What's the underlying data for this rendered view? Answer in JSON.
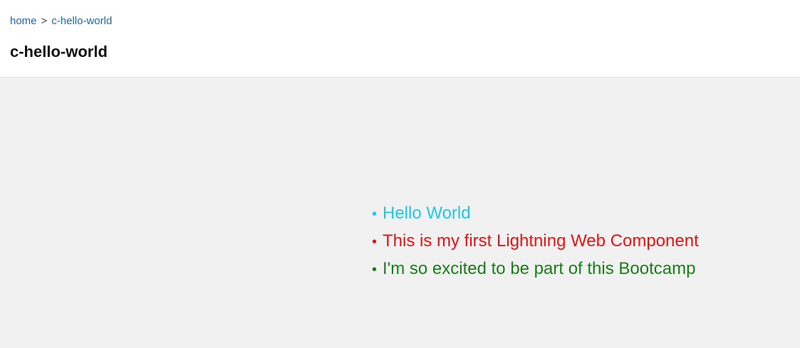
{
  "breadcrumb": {
    "home": "home",
    "separator": ">",
    "current": "c-hello-world"
  },
  "page": {
    "title": "c-hello-world"
  },
  "list": {
    "items": [
      {
        "text": "Hello World",
        "color": "#1ec8e8"
      },
      {
        "text": "This is my first Lightning Web Component",
        "color": "#ee1111"
      },
      {
        "text": "I'm so excited to be part of this Bootcamp",
        "color": "#1a7d1a"
      }
    ]
  },
  "colors": {
    "link": "#1a66b8",
    "header_bg": "#ffffff",
    "content_bg": "#f1f1f1"
  }
}
